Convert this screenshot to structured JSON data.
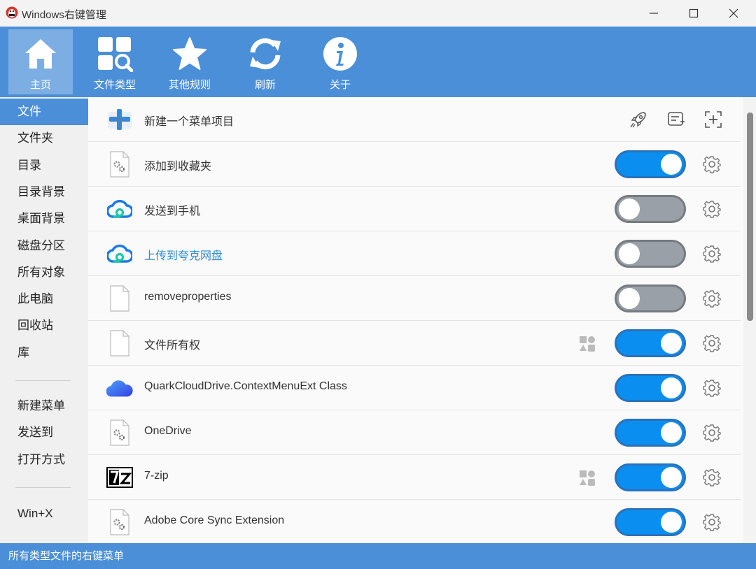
{
  "window": {
    "title": "Windows右键管理"
  },
  "toolbar": {
    "items": [
      {
        "label": "主页",
        "icon": "home-icon",
        "active": true
      },
      {
        "label": "文件类型",
        "icon": "filetype-search-icon"
      },
      {
        "label": "其他规则",
        "icon": "star-icon"
      },
      {
        "label": "刷新",
        "icon": "refresh-icon"
      },
      {
        "label": "关于",
        "icon": "info-icon"
      }
    ]
  },
  "sidebar": {
    "items": [
      {
        "label": "文件",
        "active": true
      },
      {
        "label": "文件夹"
      },
      {
        "label": "目录"
      },
      {
        "label": "目录背景"
      },
      {
        "label": "桌面背景"
      },
      {
        "label": "磁盘分区"
      },
      {
        "label": "所有对象"
      },
      {
        "label": "此电脑"
      },
      {
        "label": "回收站"
      },
      {
        "label": "库"
      }
    ],
    "group2": [
      {
        "label": "新建菜单"
      },
      {
        "label": "发送到"
      },
      {
        "label": "打开方式"
      }
    ],
    "group3": [
      {
        "label": "Win+X"
      }
    ]
  },
  "new_item": {
    "label": "新建一个菜单项目"
  },
  "rows": [
    {
      "name": "添加到收藏夹",
      "icon": "gear-doc-icon",
      "enabled": true
    },
    {
      "name": "发送到手机",
      "icon": "cloud-icon",
      "enabled": false
    },
    {
      "name": "上传到夸克网盘",
      "icon": "cloud-icon",
      "enabled": false,
      "link": true
    },
    {
      "name": "removeproperties",
      "icon": "blank-doc-icon",
      "enabled": false
    },
    {
      "name": "文件所有权",
      "icon": "blank-doc-icon",
      "enabled": true,
      "shapes": true
    },
    {
      "name": "QuarkCloudDrive.ContextMenuExt Class",
      "icon": "quark-cloud-icon",
      "enabled": true
    },
    {
      "name": "OneDrive",
      "icon": "gear-doc-icon",
      "enabled": true
    },
    {
      "name": "7-zip",
      "icon": "7zip-icon",
      "enabled": true,
      "shapes": true
    },
    {
      "name": "Adobe Core Sync Extension",
      "icon": "gear-doc-icon",
      "enabled": true
    }
  ],
  "status": {
    "text": "所有类型文件的右键菜单"
  },
  "colors": {
    "accent": "#4a8fd8",
    "toggle_on": "#0a8ff0",
    "toggle_off": "#9aa0a8"
  }
}
